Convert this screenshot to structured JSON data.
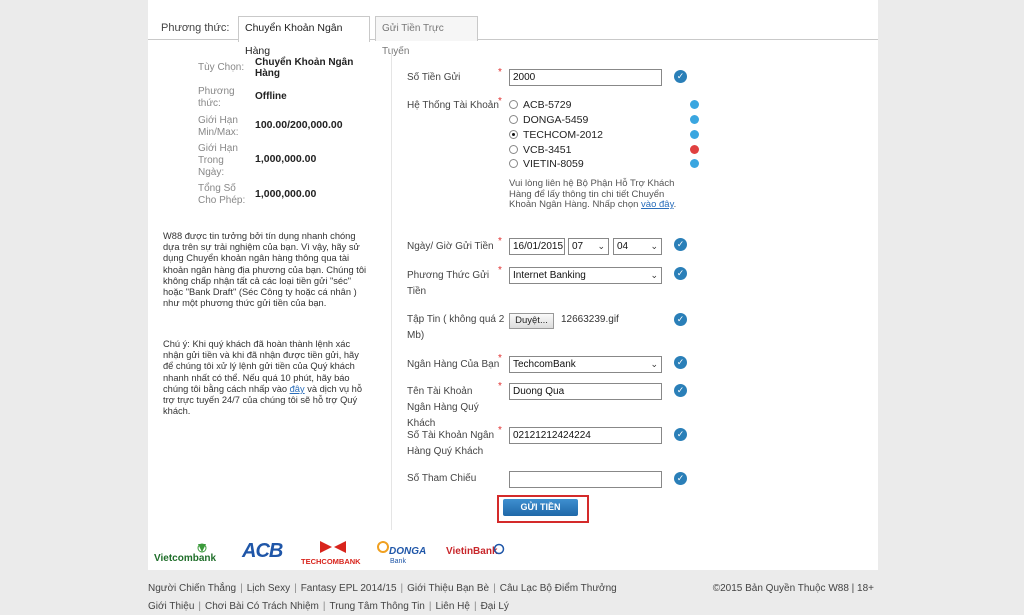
{
  "tabs": {
    "label": "Phương thức:",
    "items": [
      "Chuyển Khoản Ngân Hàng",
      "Gửi Tiền Trực Tuyến"
    ]
  },
  "info": [
    {
      "key": "Tùy Chọn:",
      "value": "Chuyển Khoản Ngân Hàng"
    },
    {
      "key": "Phương thức:",
      "value": "Offline"
    },
    {
      "key": "Giới Hạn Min/Max:",
      "value": "100.00/200,000.00"
    },
    {
      "key": "Giới Hạn Trong Ngày:",
      "value": "1,000,000.00"
    },
    {
      "key": "Tổng Số Cho Phép:",
      "value": "1,000,000.00"
    }
  ],
  "left_text": {
    "para1": "W88 được tin tưởng bởi tín dụng nhanh chóng dựa trên sự trải nghiệm của bạn. Vì vậy, hãy sử dụng Chuyển khoản ngân hàng thông qua tài khoản ngân hàng địa phương của bạn. Chúng tôi không chấp nhận tất cả các loại tiền gửi \"séc\" hoặc \"Bank Draft\" (Séc Công ty hoặc cá nhân ) như một phương thức gửi tiền của bạn.",
    "para2_a": "Chú ý: Khi quý khách đã hoàn thành lệnh xác nhận gửi tiền và khi đã nhận được tiền gửi, hãy để chúng tôi xử lý lệnh gửi tiền của Quý khách nhanh nhất có thể. Nếu quá 10 phút, hãy báo chúng tôi bằng cách nhấp vào ",
    "para2_link": "đây",
    "para2_b": " và dịch vụ hỗ trợ trực tuyến 24/7 của chúng tôi sẽ hỗ trợ Quý khách."
  },
  "form": {
    "amount_label": "Số Tiền Gửi",
    "amount_value": "2000",
    "account_system_label": "Hệ Thống Tài Khoản",
    "banks": [
      {
        "name": "ACB-5729",
        "selected": false,
        "status_color": "#3aa6e0"
      },
      {
        "name": "DONGA-5459",
        "selected": false,
        "status_color": "#3aa6e0"
      },
      {
        "name": "TECHCOM-2012",
        "selected": true,
        "status_color": "#3aa6e0"
      },
      {
        "name": "VCB-3451",
        "selected": false,
        "status_color": "#e04040"
      },
      {
        "name": "VIETIN-8059",
        "selected": false,
        "status_color": "#3aa6e0"
      }
    ],
    "note_text": "Vui lòng liên hệ Bộ Phận Hỗ Trợ Khách Hàng để lấy thông tin chi tiết Chuyển Khoản Ngân Hàng. Nhấp chọn ",
    "note_link": "vào đây",
    "note_end": ".",
    "datetime_label": "Ngày/ Giờ Gửi Tiền",
    "date_value": "16/01/2015",
    "hour_value": "07",
    "minute_value": "04",
    "method_label": "Phương Thức Gửi Tiền",
    "method_value": "Internet Banking",
    "file_label": "Tập Tin ( không quá 2 Mb)",
    "browse_label": "Duyệt...",
    "file_name": "12663239.gif",
    "your_bank_label": "Ngân Hàng Của Bạn",
    "your_bank_value": "TechcomBank",
    "account_name_label": "Tên Tài Khoản Ngân Hàng Quý Khách",
    "account_name_value": "Duong Qua",
    "account_number_label": "Số Tài Khoản Ngân Hàng Quý Khách",
    "account_number_value": "02121212424224",
    "reference_label": "Số Tham Chiếu",
    "reference_value": "",
    "submit_label": "GỬI TIỀN"
  },
  "logos": {
    "vietcombank": "Vietcombank",
    "acb": "ACB",
    "techcombank": "TECHCOMBANK",
    "donga": "DONGA",
    "donga_sub": "Bank",
    "vietinbank": "VietinBank"
  },
  "footer": {
    "row1": [
      "Người Chiến Thắng",
      "Lịch Sexy",
      "Fantasy EPL 2014/15",
      "Giới Thiệu Bạn Bè",
      "Câu Lạc Bộ Điểm Thưởng"
    ],
    "row2": [
      "Giới Thiệu",
      "Chơi Bài Có Trách Nhiệm",
      "Trung Tâm Thông Tin",
      "Liên Hệ",
      "Đại Lý"
    ],
    "copyright": "©2015 Bản Quyền Thuộc W88 | 18+"
  },
  "colors": {
    "accent": "#2a7fb8",
    "required": "#e03030",
    "highlight": "#d42a2a"
  }
}
